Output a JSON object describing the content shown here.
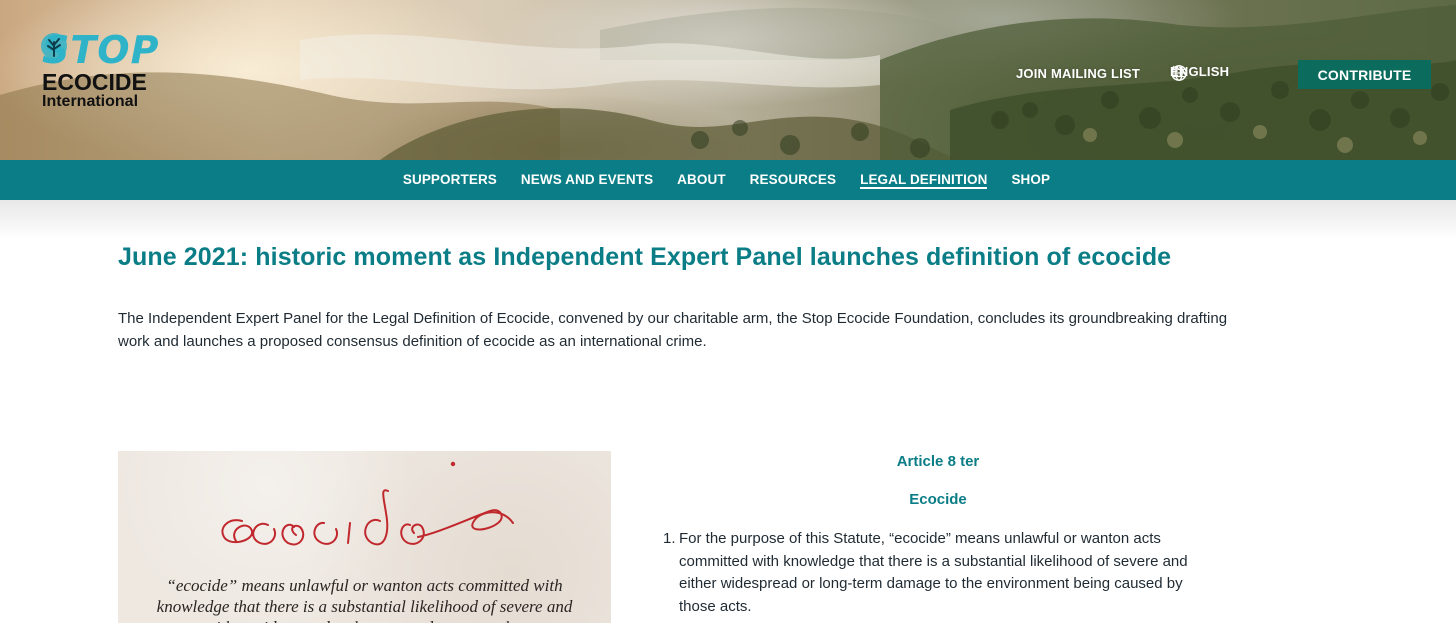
{
  "logo": {
    "line1": "STOP",
    "line2": "ECOCIDE",
    "line3": "International"
  },
  "header": {
    "join_label": "JOIN MAILING LIST",
    "language": "ENGLISH",
    "contribute_label": "CONTRIBUTE"
  },
  "nav": {
    "items": [
      {
        "label": "SUPPORTERS"
      },
      {
        "label": "NEWS AND EVENTS"
      },
      {
        "label": "ABOUT"
      },
      {
        "label": "RESOURCES"
      },
      {
        "label": "LEGAL DEFINITION",
        "active": true
      },
      {
        "label": "SHOP"
      }
    ]
  },
  "main": {
    "headline": "June 2021: historic moment as Independent Expert Panel launches definition of ecocide",
    "intro": "The Independent Expert Panel for the Legal Definition of Ecocide, convened by our charitable arm, the Stop Ecocide Foundation, concludes its groundbreaking drafting work and launches a proposed consensus definition of ecocide as an international crime.",
    "poster": {
      "script_word": "ecocide",
      "quote": "“ecocide” means unlawful or wanton acts committed with knowledge that there is a substantial likelihood of severe and either widespread or long-term damage to the"
    },
    "article": {
      "number": "Article 8 ter",
      "title": "Ecocide",
      "items": [
        {
          "num": "1.",
          "text": "For the purpose of this Statute, “ecocide” means unlawful or wanton acts committed with knowledge that there is a substantial likelihood of severe and either widespread or long-term damage to the environment being caused by those acts."
        }
      ]
    }
  },
  "colors": {
    "teal": "#0b7d86",
    "contribute_green": "#0b6c5d",
    "logo_cyan": "#2fb3c8",
    "script_red": "#c0282d"
  },
  "icons": [
    "globe-icon",
    "chevron-down-icon",
    "tree-icon"
  ]
}
